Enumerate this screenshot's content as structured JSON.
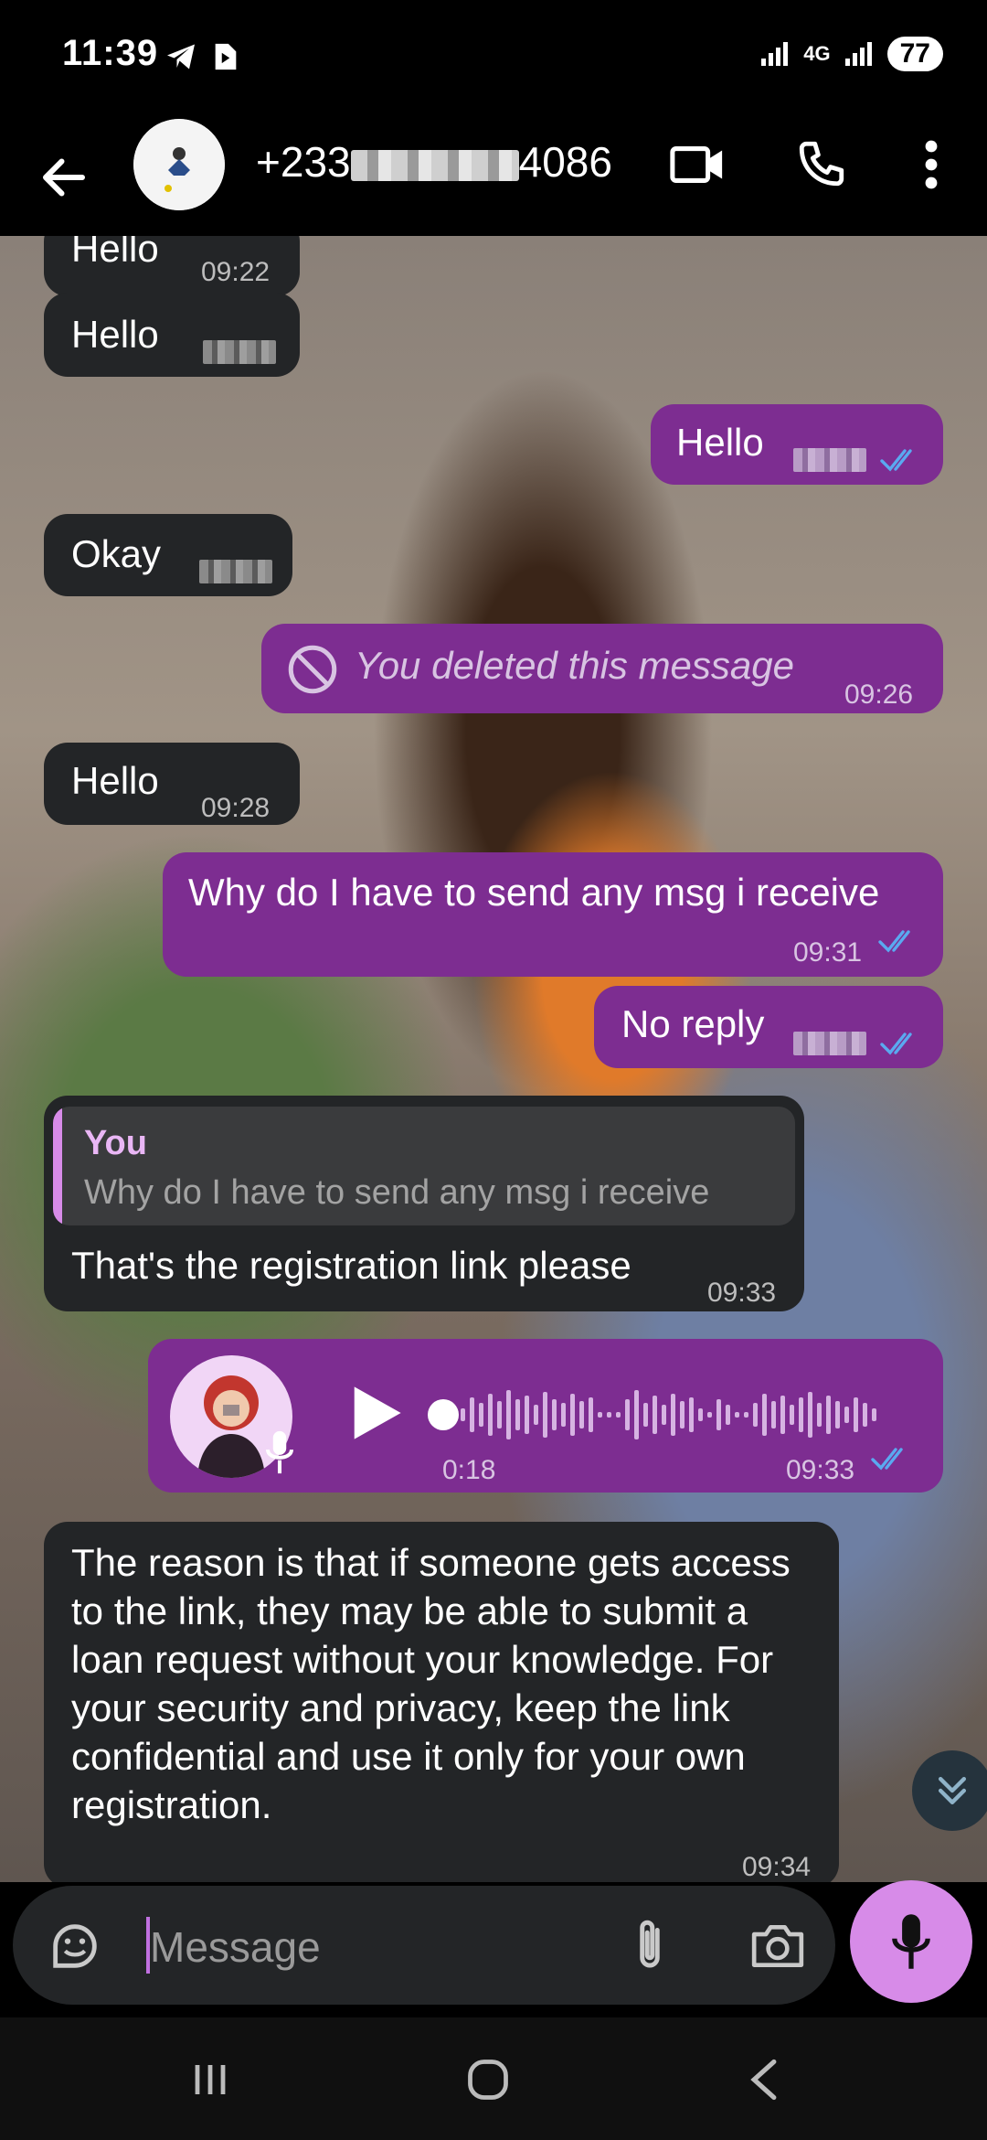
{
  "status_bar": {
    "time": "11:39",
    "network": "4G",
    "battery": "77"
  },
  "header": {
    "contact_prefix": "+233",
    "contact_suffix": "4086"
  },
  "messages": [
    {
      "dir": "in",
      "text": "Hello",
      "time": "09:22"
    },
    {
      "dir": "in",
      "text": "Hello"
    },
    {
      "dir": "out",
      "text": "Hello"
    },
    {
      "dir": "in",
      "text": "Okay"
    },
    {
      "dir": "out",
      "text": "You deleted this message",
      "time": "09:26",
      "deleted": true
    },
    {
      "dir": "in",
      "text": "Hello",
      "time": "09:28"
    },
    {
      "dir": "out",
      "text": "Why do I have to send any msg i receive",
      "time": "09:31"
    },
    {
      "dir": "out",
      "text": "No reply"
    },
    {
      "dir": "in",
      "reply_author": "You",
      "reply_text": "Why do I have to send any msg i receive",
      "text": "That's the registration link please",
      "time": "09:33"
    },
    {
      "dir": "out",
      "voice": true,
      "duration": "0:18",
      "time": "09:33"
    },
    {
      "dir": "in",
      "text": "The reason is that if someone gets access to the link, they may be able to submit a loan request without your knowledge. For your security and privacy, keep the link confidential and use it only for your own registration.",
      "time": "09:34"
    }
  ],
  "input": {
    "placeholder": "Message"
  },
  "colors": {
    "outgoing_bubble": "#7d2d91",
    "incoming_bubble": "#232527",
    "accent": "#d78be8",
    "read_ticks": "#5aa9f0"
  }
}
